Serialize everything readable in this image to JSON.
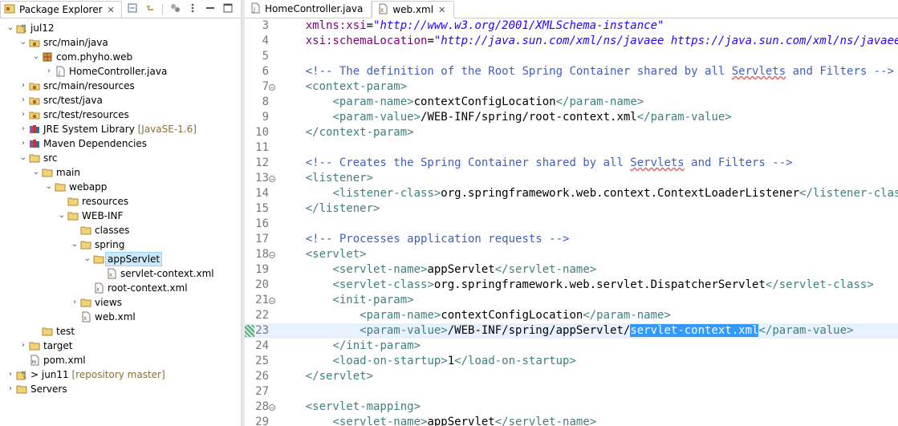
{
  "package_explorer": {
    "title": "Package Explorer",
    "close": "✕",
    "items": [
      {
        "label": "jul12",
        "decor": "",
        "level": 0,
        "expanded": true,
        "icon": "project-icon"
      },
      {
        "label": "src/main/java",
        "decor": "",
        "level": 1,
        "expanded": true,
        "icon": "source-folder-icon"
      },
      {
        "label": "com.phyho.web",
        "decor": "",
        "level": 2,
        "expanded": true,
        "icon": "package-icon"
      },
      {
        "label": "HomeController.java",
        "decor": "",
        "level": 3,
        "expanded": false,
        "icon": "java-file-icon"
      },
      {
        "label": "src/main/resources",
        "decor": "",
        "level": 1,
        "expanded": false,
        "icon": "source-folder-icon"
      },
      {
        "label": "src/test/java",
        "decor": "",
        "level": 1,
        "expanded": false,
        "icon": "source-folder-icon"
      },
      {
        "label": "src/test/resources",
        "decor": "",
        "level": 1,
        "expanded": false,
        "icon": "source-folder-icon"
      },
      {
        "label": "JRE System Library",
        "decor": "[JavaSE-1.6]",
        "level": 1,
        "expanded": false,
        "icon": "library-icon"
      },
      {
        "label": "Maven Dependencies",
        "decor": "",
        "level": 1,
        "expanded": false,
        "icon": "library-icon"
      },
      {
        "label": "src",
        "decor": "",
        "level": 1,
        "expanded": true,
        "icon": "folder-icon"
      },
      {
        "label": "main",
        "decor": "",
        "level": 2,
        "expanded": true,
        "icon": "folder-icon"
      },
      {
        "label": "webapp",
        "decor": "",
        "level": 3,
        "expanded": true,
        "icon": "folder-icon"
      },
      {
        "label": "resources",
        "decor": "",
        "level": 4,
        "expanded": null,
        "icon": "folder-icon"
      },
      {
        "label": "WEB-INF",
        "decor": "",
        "level": 4,
        "expanded": true,
        "icon": "folder-icon"
      },
      {
        "label": "classes",
        "decor": "",
        "level": 5,
        "expanded": null,
        "icon": "folder-icon"
      },
      {
        "label": "spring",
        "decor": "",
        "level": 5,
        "expanded": true,
        "icon": "folder-icon"
      },
      {
        "label": "appServlet",
        "decor": "",
        "level": 6,
        "expanded": true,
        "icon": "folder-icon",
        "selected": true
      },
      {
        "label": "servlet-context.xml",
        "decor": "",
        "level": 7,
        "expanded": null,
        "icon": "xml-file-icon"
      },
      {
        "label": "root-context.xml",
        "decor": "",
        "level": 6,
        "expanded": null,
        "icon": "xml-file-icon"
      },
      {
        "label": "views",
        "decor": "",
        "level": 5,
        "expanded": false,
        "icon": "folder-icon"
      },
      {
        "label": "web.xml",
        "decor": "",
        "level": 5,
        "expanded": null,
        "icon": "xml-file-icon"
      },
      {
        "label": "test",
        "decor": "",
        "level": 2,
        "expanded": null,
        "icon": "folder-icon"
      },
      {
        "label": "target",
        "decor": "",
        "level": 1,
        "expanded": false,
        "icon": "folder-icon"
      },
      {
        "label": "pom.xml",
        "decor": "",
        "level": 1,
        "expanded": null,
        "icon": "pom-file-icon"
      },
      {
        "label": "> jun11",
        "decor": "[repository master]",
        "level": 0,
        "expanded": false,
        "icon": "project-icon"
      },
      {
        "label": "Servers",
        "decor": "",
        "level": 0,
        "expanded": false,
        "icon": "folder-icon"
      }
    ]
  },
  "editor": {
    "tabs": [
      {
        "label": "HomeController.java",
        "active": false,
        "icon": "java-file-icon"
      },
      {
        "label": "web.xml",
        "active": true,
        "icon": "xml-file-icon",
        "close": "✕"
      }
    ],
    "current_line": 23,
    "lines": [
      {
        "n": "3",
        "fold": false,
        "segs": [
          [
            "t-txt",
            "    "
          ],
          [
            "t-attr",
            "xmlns:xsi"
          ],
          [
            "t-txt",
            "="
          ],
          [
            "t-val",
            "\"http://www.w3.org/2001/XMLSchema-instance\""
          ]
        ]
      },
      {
        "n": "4",
        "fold": false,
        "segs": [
          [
            "t-txt",
            "    "
          ],
          [
            "t-attr",
            "xsi:schemaLocation"
          ],
          [
            "t-txt",
            "="
          ],
          [
            "t-val",
            "\"http://java.sun.com/xml/ns/javaee https://java.sun.com/xml/ns/javaee/web-"
          ]
        ]
      },
      {
        "n": "5",
        "fold": false,
        "segs": []
      },
      {
        "n": "6",
        "fold": false,
        "segs": [
          [
            "t-txt",
            "    "
          ],
          [
            "t-com",
            "<!-- The definition of the Root Spring Container shared by all "
          ],
          [
            "t-com squig",
            "Servlets"
          ],
          [
            "t-com",
            " and Filters -->"
          ]
        ]
      },
      {
        "n": "7",
        "fold": true,
        "segs": [
          [
            "t-txt",
            "    "
          ],
          [
            "t-tag",
            "<context-param>"
          ]
        ]
      },
      {
        "n": "8",
        "fold": false,
        "segs": [
          [
            "t-txt",
            "        "
          ],
          [
            "t-tag",
            "<param-name>"
          ],
          [
            "t-txt",
            "contextConfigLocation"
          ],
          [
            "t-tag",
            "</param-name>"
          ]
        ]
      },
      {
        "n": "9",
        "fold": false,
        "segs": [
          [
            "t-txt",
            "        "
          ],
          [
            "t-tag",
            "<param-value>"
          ],
          [
            "t-txt",
            "/WEB-INF/spring/root-context.xml"
          ],
          [
            "t-tag",
            "</param-value>"
          ]
        ]
      },
      {
        "n": "10",
        "fold": false,
        "segs": [
          [
            "t-txt",
            "    "
          ],
          [
            "t-tag",
            "</context-param>"
          ]
        ]
      },
      {
        "n": "11",
        "fold": false,
        "segs": []
      },
      {
        "n": "12",
        "fold": false,
        "segs": [
          [
            "t-txt",
            "    "
          ],
          [
            "t-com",
            "<!-- Creates the Spring Container shared by all "
          ],
          [
            "t-com squig",
            "Servlets"
          ],
          [
            "t-com",
            " and Filters -->"
          ]
        ]
      },
      {
        "n": "13",
        "fold": true,
        "segs": [
          [
            "t-txt",
            "    "
          ],
          [
            "t-tag",
            "<listener>"
          ]
        ]
      },
      {
        "n": "14",
        "fold": false,
        "segs": [
          [
            "t-txt",
            "        "
          ],
          [
            "t-tag",
            "<listener-class>"
          ],
          [
            "t-txt",
            "org.springframework.web.context.ContextLoaderListener"
          ],
          [
            "t-tag",
            "</listener-class>"
          ]
        ]
      },
      {
        "n": "15",
        "fold": false,
        "segs": [
          [
            "t-txt",
            "    "
          ],
          [
            "t-tag",
            "</listener>"
          ]
        ]
      },
      {
        "n": "16",
        "fold": false,
        "segs": []
      },
      {
        "n": "17",
        "fold": false,
        "segs": [
          [
            "t-txt",
            "    "
          ],
          [
            "t-com",
            "<!-- Processes application requests -->"
          ]
        ]
      },
      {
        "n": "18",
        "fold": true,
        "segs": [
          [
            "t-txt",
            "    "
          ],
          [
            "t-tag",
            "<servlet>"
          ]
        ]
      },
      {
        "n": "19",
        "fold": false,
        "segs": [
          [
            "t-txt",
            "        "
          ],
          [
            "t-tag",
            "<servlet-name>"
          ],
          [
            "t-txt",
            "appServlet"
          ],
          [
            "t-tag",
            "</servlet-name>"
          ]
        ]
      },
      {
        "n": "20",
        "fold": false,
        "segs": [
          [
            "t-txt",
            "        "
          ],
          [
            "t-tag",
            "<servlet-class>"
          ],
          [
            "t-txt",
            "org.springframework.web.servlet.DispatcherServlet"
          ],
          [
            "t-tag",
            "</servlet-class>"
          ]
        ]
      },
      {
        "n": "21",
        "fold": true,
        "segs": [
          [
            "t-txt",
            "        "
          ],
          [
            "t-tag",
            "<init-param>"
          ]
        ]
      },
      {
        "n": "22",
        "fold": false,
        "segs": [
          [
            "t-txt",
            "            "
          ],
          [
            "t-tag",
            "<param-name>"
          ],
          [
            "t-txt",
            "contextConfigLocation"
          ],
          [
            "t-tag",
            "</param-name>"
          ]
        ]
      },
      {
        "n": "23",
        "fold": false,
        "segs": [
          [
            "t-txt",
            "            "
          ],
          [
            "t-tag",
            "<param-value>"
          ],
          [
            "t-txt",
            "/WEB-INF/spring/appServlet/"
          ],
          [
            "t-sel",
            "servlet-context.xml"
          ],
          [
            "t-tag",
            "</param-value>"
          ]
        ]
      },
      {
        "n": "24",
        "fold": false,
        "segs": [
          [
            "t-txt",
            "        "
          ],
          [
            "t-tag",
            "</init-param>"
          ]
        ]
      },
      {
        "n": "25",
        "fold": false,
        "segs": [
          [
            "t-txt",
            "        "
          ],
          [
            "t-tag",
            "<load-on-startup>"
          ],
          [
            "t-txt",
            "1"
          ],
          [
            "t-tag",
            "</load-on-startup>"
          ]
        ]
      },
      {
        "n": "26",
        "fold": false,
        "segs": [
          [
            "t-txt",
            "    "
          ],
          [
            "t-tag",
            "</servlet>"
          ]
        ]
      },
      {
        "n": "27",
        "fold": false,
        "segs": []
      },
      {
        "n": "28",
        "fold": true,
        "segs": [
          [
            "t-txt",
            "    "
          ],
          [
            "t-tag",
            "<servlet-mapping>"
          ]
        ]
      },
      {
        "n": "29",
        "fold": false,
        "segs": [
          [
            "t-txt",
            "        "
          ],
          [
            "t-tag",
            "<servlet-name>"
          ],
          [
            "t-txt",
            "appServlet"
          ],
          [
            "t-tag",
            "</servlet-name>"
          ]
        ]
      }
    ]
  }
}
